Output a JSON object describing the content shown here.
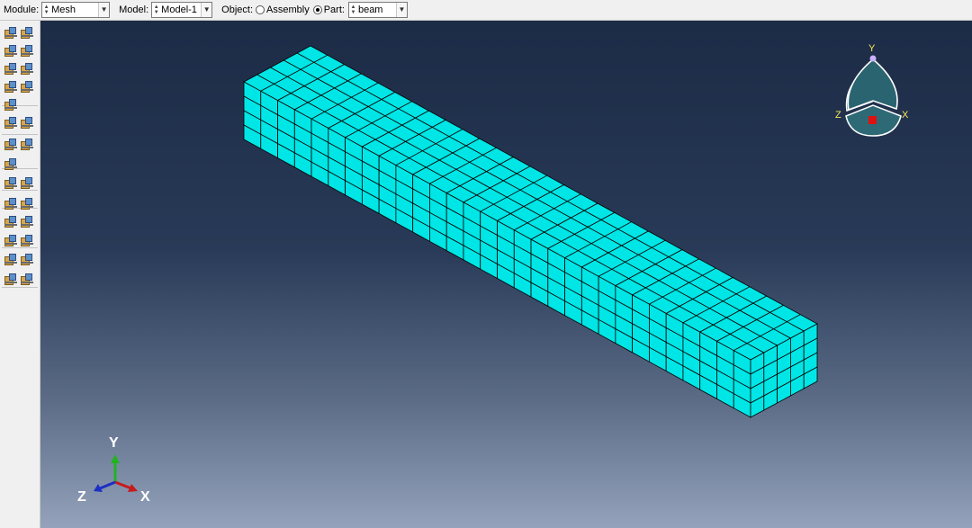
{
  "toolbar": {
    "module_label": "Module:",
    "module_value": "Mesh",
    "model_label": "Model:",
    "model_value": "Model-1",
    "object_label": "Object:",
    "assembly_label": "Assembly",
    "part_label": "Part:",
    "part_value": "beam"
  },
  "viewport": {
    "mesh": {
      "length_divisions": 30,
      "width_divisions": 5,
      "height_divisions": 4,
      "color": "#00e6e6"
    },
    "triad": {
      "x": "X",
      "y": "Y",
      "z": "Z"
    },
    "viewcube": {
      "x": "X",
      "y": "Y",
      "z": "Z"
    }
  },
  "tools": [
    "seed-part-icon",
    "seed-edge-icon",
    "seed-by-number-icon",
    "delete-seeds-icon",
    "assign-mesh-controls-icon",
    "assign-element-type-icon",
    "mesh-part-icon",
    "verify-mesh-icon",
    "partition-cell-icon",
    "partition-edge-icon",
    "query-icon",
    "virtual-topology-icon",
    "create-datum-icon",
    "datum-plane-icon",
    "edit-mesh-icon",
    "edit-mesh-node-icon",
    "select-region-icon",
    "delete-mesh-icon",
    "edit-element-icon",
    "create-csys-icon",
    "datum-axis-icon",
    "datum-csys-icon",
    "assign-stack-icon",
    "mesh-region-icon",
    "sweep-icon",
    "settings-icon"
  ]
}
